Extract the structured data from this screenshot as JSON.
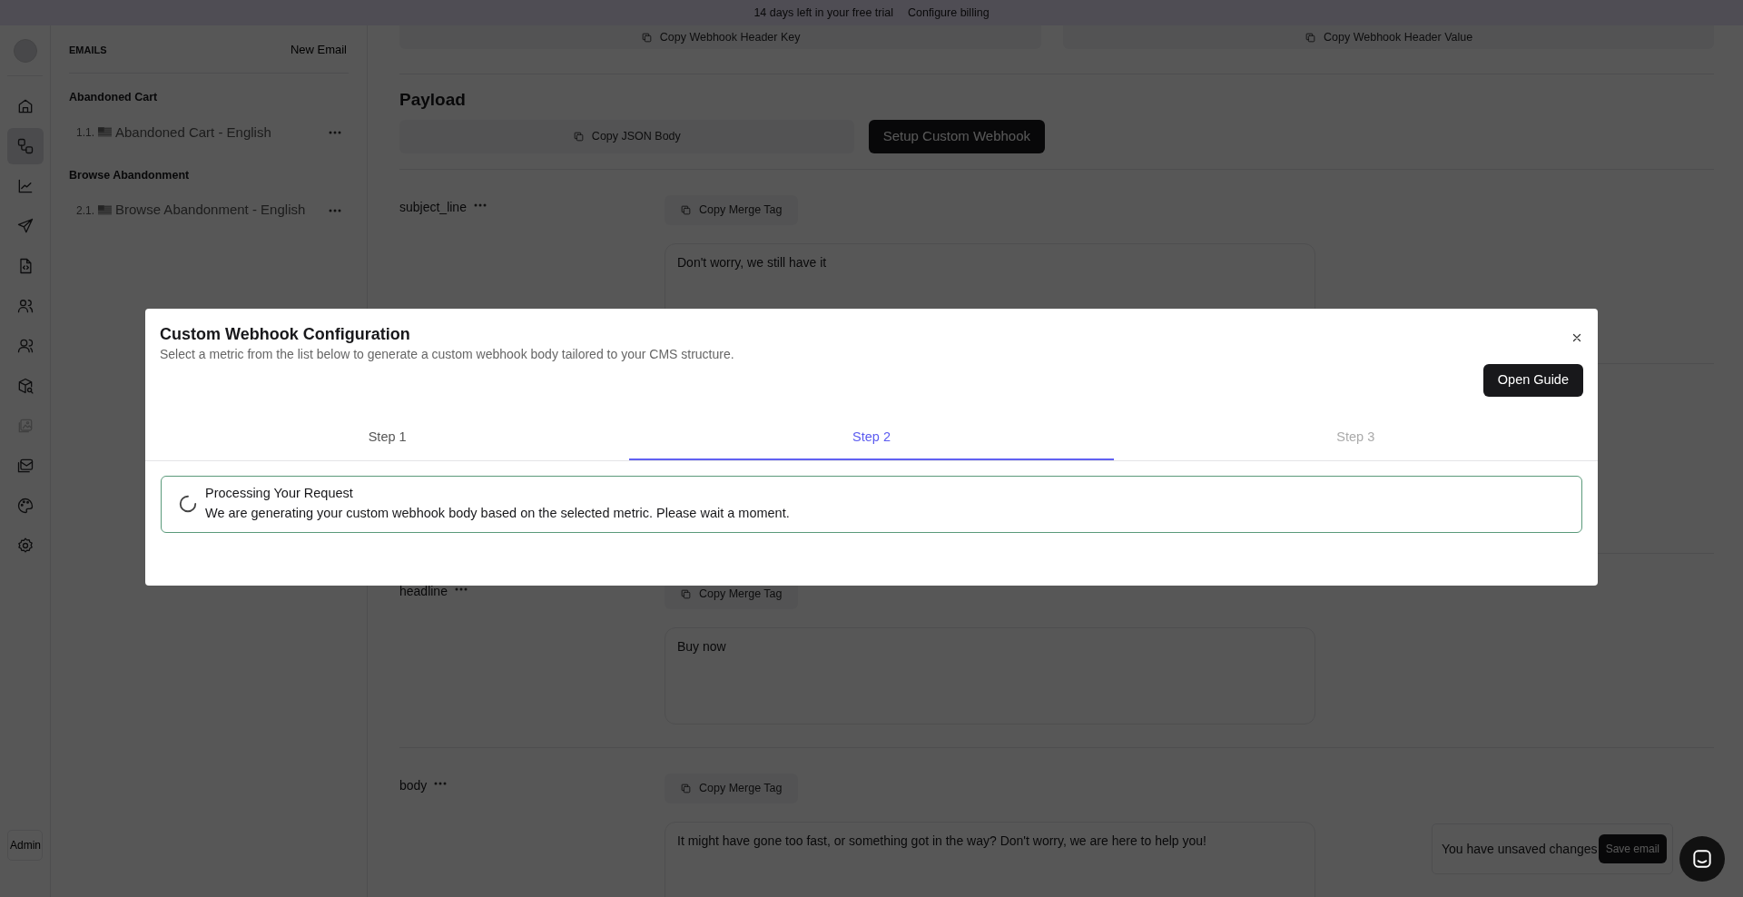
{
  "banner": {
    "text": "14 days left in your free trial",
    "link": "Configure billing"
  },
  "rail": {
    "items": [
      {
        "selected": false,
        "disabled": false
      },
      {
        "selected": true,
        "disabled": false
      },
      {
        "selected": false,
        "disabled": false
      },
      {
        "selected": false,
        "disabled": false
      },
      {
        "selected": false,
        "disabled": false
      },
      {
        "selected": false,
        "disabled": false
      },
      {
        "selected": false,
        "disabled": false
      },
      {
        "selected": false,
        "disabled": false
      },
      {
        "selected": false,
        "disabled": true
      },
      {
        "selected": false,
        "disabled": false
      },
      {
        "selected": false,
        "disabled": false
      },
      {
        "selected": false,
        "disabled": false
      }
    ],
    "admin_button": "Admin"
  },
  "sidebar": {
    "title": "EMAILS",
    "new_button": "New Email",
    "groups": [
      {
        "title": "Abandoned Cart",
        "items": [
          {
            "number": "1.1.",
            "label": "Abandoned Cart - English"
          }
        ]
      },
      {
        "title": "Browse Abandonment",
        "items": [
          {
            "number": "2.1.",
            "label": "Browse Abandonment - English"
          }
        ]
      }
    ]
  },
  "main": {
    "header_buttons": [
      "Copy Webhook Header Key",
      "Copy Webhook Header Value"
    ],
    "payload": {
      "title": "Payload",
      "copy_button": "Copy JSON Body",
      "setup_button": "Setup Custom Webhook"
    },
    "fields": [
      {
        "name": "subject_line",
        "copy_button": "Copy Merge Tag",
        "value": "Don't worry, we still have it"
      },
      {
        "name": "headline",
        "copy_button": "Copy Merge Tag",
        "value": "Buy now"
      },
      {
        "name": "body",
        "copy_button": "Copy Merge Tag",
        "value": "It might have gone too fast, or something got in the way? Don't worry, we are here to help you!"
      }
    ]
  },
  "modal": {
    "title": "Custom Webhook Configuration",
    "subtitle": "Select a metric from the list below to generate a custom webhook body tailored to your CMS structure.",
    "guide_button": "Open Guide",
    "steps": [
      {
        "label": "Step 1",
        "selected": false,
        "disabled": false
      },
      {
        "label": "Step 2",
        "selected": true,
        "disabled": false
      },
      {
        "label": "Step 3",
        "selected": false,
        "disabled": true
      }
    ],
    "alert": {
      "title": "Processing Your Request",
      "message": "We are generating your custom webhook body based on the selected metric. Please wait a moment."
    }
  },
  "toast": {
    "text": "You have unsaved changes",
    "button": "Save email"
  }
}
